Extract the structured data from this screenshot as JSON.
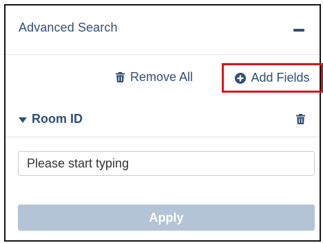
{
  "panel": {
    "title": "Advanced Search",
    "collapse_icon": "minus-icon"
  },
  "actions": {
    "remove_all_label": "Remove All",
    "remove_all_icon": "trash-icon",
    "add_fields_label": "Add Fields",
    "add_fields_icon": "plus-circle-icon",
    "highlight_color": "#e0101a"
  },
  "field": {
    "label": "Room ID",
    "expand_icon": "caret-down-icon",
    "delete_icon": "trash-icon",
    "input_placeholder": "Please start typing",
    "input_value": ""
  },
  "apply": {
    "label": "Apply",
    "state": "disabled"
  },
  "colors": {
    "text": "#2f4f78",
    "apply_bg": "#b3c4d6",
    "divider": "#dfe3e8"
  }
}
